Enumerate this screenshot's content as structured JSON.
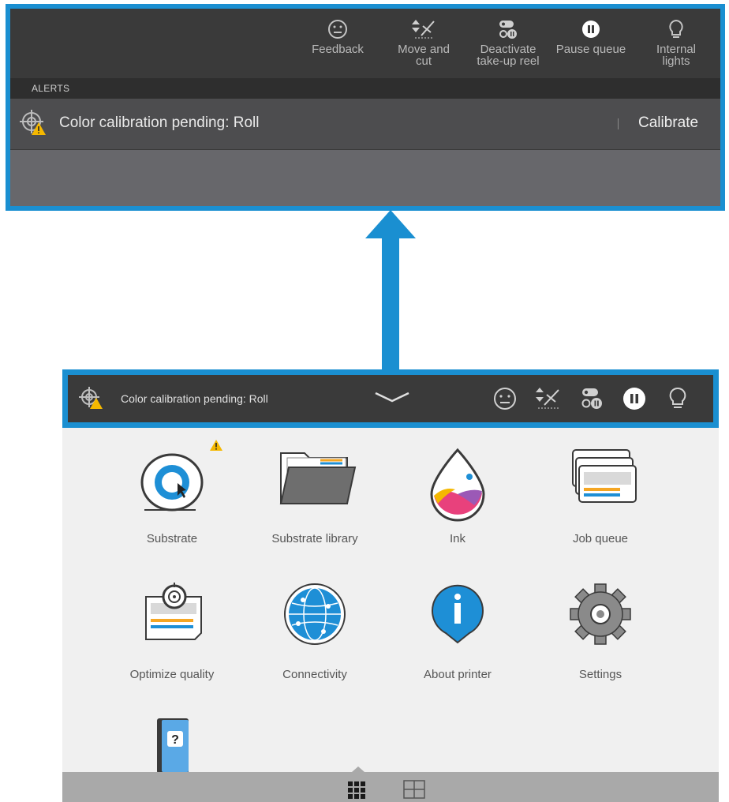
{
  "top_toolbar": {
    "items": [
      {
        "label_line1": "Feedback",
        "label_line2": "",
        "icon": "smiley-icon"
      },
      {
        "label_line1": "Move and",
        "label_line2": "cut",
        "icon": "move-and-cut-icon"
      },
      {
        "label_line1": "Deactivate",
        "label_line2": "take-up reel",
        "icon": "take-up-reel-icon"
      },
      {
        "label_line1": "Pause queue",
        "label_line2": "",
        "icon": "pause-icon"
      },
      {
        "label_line1": "Internal",
        "label_line2": "lights",
        "icon": "lightbulb-icon"
      }
    ]
  },
  "alerts": {
    "header": "ALERTS",
    "item": {
      "text": "Color calibration pending: Roll",
      "action": "Calibrate",
      "icon": "calibration-warning-icon"
    }
  },
  "status_bar": {
    "text": "Color calibration pending: Roll"
  },
  "tiles": [
    {
      "label": "Substrate",
      "icon": "substrate-roll-icon",
      "warning": true
    },
    {
      "label": "Substrate library",
      "icon": "folder-icon",
      "warning": false
    },
    {
      "label": "Ink",
      "icon": "ink-drop-icon",
      "warning": false
    },
    {
      "label": "Job queue",
      "icon": "job-queue-icon",
      "warning": false
    },
    {
      "label": "Optimize quality",
      "icon": "optimize-quality-icon",
      "warning": false
    },
    {
      "label": "Connectivity",
      "icon": "globe-icon",
      "warning": false
    },
    {
      "label": "About printer",
      "icon": "info-icon",
      "warning": false
    },
    {
      "label": "Settings",
      "icon": "gear-icon",
      "warning": false
    },
    {
      "label": "",
      "icon": "help-book-icon",
      "warning": false
    }
  ],
  "colors": {
    "highlight_blue": "#1a8fd1",
    "toolbar_dark": "#3a3a3a",
    "warning_yellow": "#f5b800"
  }
}
